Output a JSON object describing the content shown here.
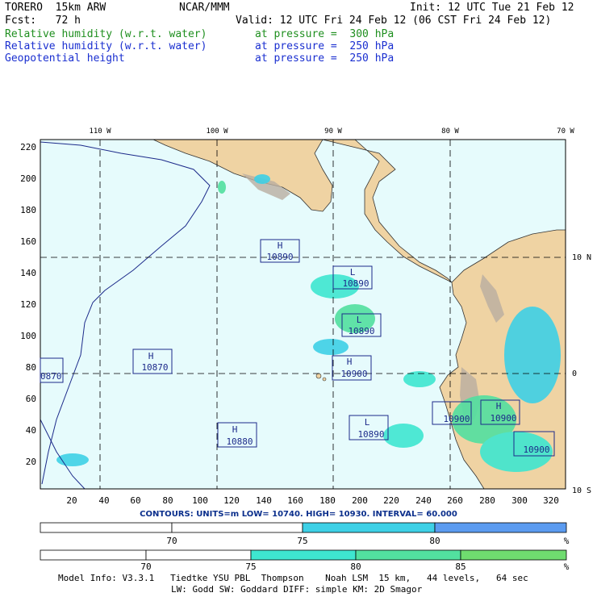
{
  "header": {
    "model": "TORERO  15km ARW",
    "center": "NCAR/MMM",
    "init": "Init: 12 UTC Tue 21 Feb 12",
    "fcst": "Fcst:   72 h",
    "valid": "Valid: 12 UTC Fri 24 Feb 12 (06 CST Fri 24 Feb 12)",
    "fields": [
      {
        "name": "Relative humidity (w.r.t. water)",
        "level": "at pressure =  300 hPa",
        "color": "#1f8f1f"
      },
      {
        "name": "Relative humidity (w.r.t. water)",
        "level": "at pressure =  250 hPa",
        "color": "#1a2fd0"
      },
      {
        "name": "Geopotential height",
        "level": "at pressure =  250 hPa",
        "color": "#1a2fd0"
      }
    ]
  },
  "map": {
    "top_lon_labels": [
      "110 W",
      "100 W",
      "90 W",
      "80 W",
      "70 W"
    ],
    "right_lat_labels": [
      "10 N",
      "0",
      "10 S"
    ],
    "left_ticks": [
      "220",
      "200",
      "180",
      "160",
      "140",
      "120",
      "100",
      "80",
      "60",
      "40",
      "20"
    ],
    "bottom_ticks": [
      "20",
      "40",
      "60",
      "80",
      "100",
      "120",
      "140",
      "160",
      "180",
      "200",
      "220",
      "240",
      "260",
      "280",
      "300",
      "320"
    ],
    "pressure_centers": [
      {
        "type": "H",
        "value": "10890"
      },
      {
        "type": "L",
        "value": "10890"
      },
      {
        "type": "L",
        "value": "10890"
      },
      {
        "type": "H",
        "value": "10870"
      },
      {
        "type": "",
        "value": "0870"
      },
      {
        "type": "H",
        "value": "10900"
      },
      {
        "type": "H",
        "value": "10880"
      },
      {
        "type": "L",
        "value": "10890"
      },
      {
        "type": "",
        "value": "10900"
      },
      {
        "type": "H",
        "value": "10900"
      },
      {
        "type": "",
        "value": "10900"
      }
    ]
  },
  "contours": {
    "text": "CONTOURS:  UNITS=m  LOW=  10740.    HIGH=  10930.    INTERVAL=  60.000"
  },
  "scale1": {
    "labels": [
      "70",
      "75",
      "80"
    ],
    "unit": "%",
    "colors": [
      "#ffffff",
      "#ffffff",
      "#3ed0e6",
      "#5b9bf0"
    ]
  },
  "scale2": {
    "labels": [
      "70",
      "75",
      "80",
      "85"
    ],
    "unit": "%",
    "colors": [
      "#ffffff",
      "#ffffff",
      "#3ee6d0",
      "#52e0a0",
      "#7ee87e",
      "#3fc93f"
    ]
  },
  "footer": {
    "line1": "Model Info: V3.3.1   Tiedtke YSU PBL  Thompson    Noah LSM  15 km,   44 levels,   64 sec",
    "line2": "LW: Godd SW: Goddard DIFF: simple KM: 2D Smagor"
  }
}
